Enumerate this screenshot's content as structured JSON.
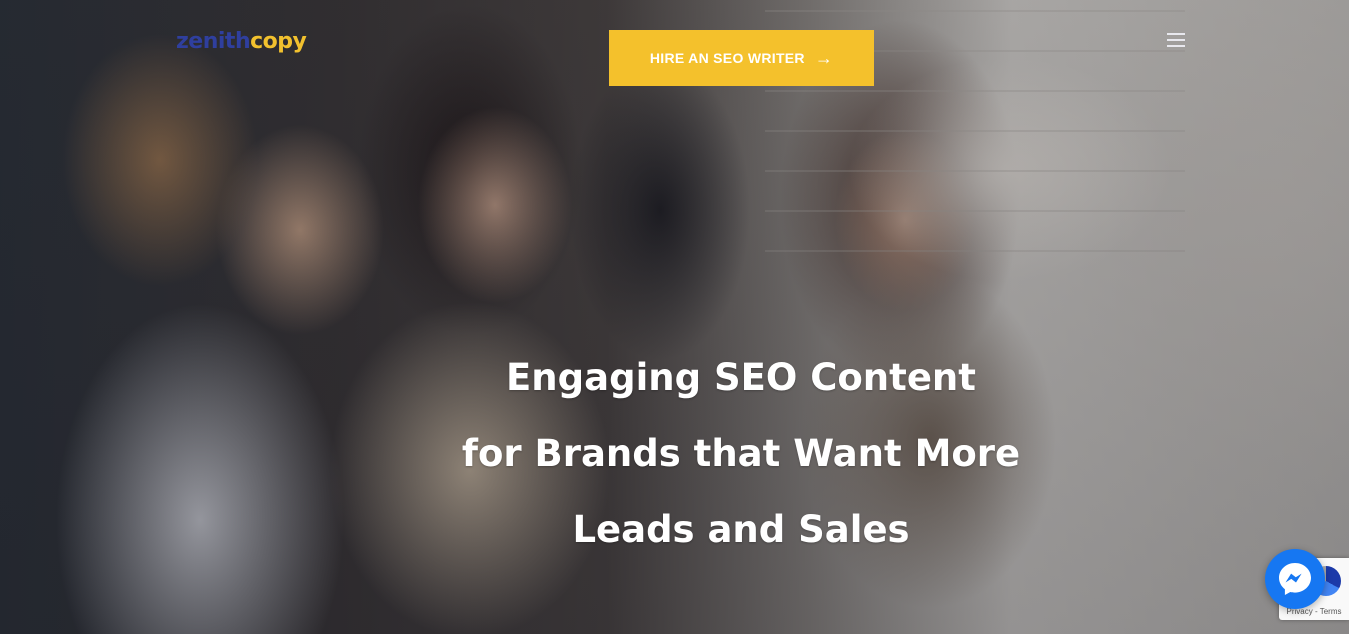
{
  "brand": {
    "logo_part1": "zenith",
    "logo_part2": "copy"
  },
  "header": {
    "cta_label": "HIRE AN SEO WRITER",
    "cta_icon": "arrow-right-icon",
    "menu_icon": "hamburger-menu-icon"
  },
  "hero": {
    "headline_line1": "Engaging SEO Content",
    "headline_line2": "for Brands that Want More",
    "headline_line3": "Leads and Sales"
  },
  "widgets": {
    "messenger_icon": "messenger-icon",
    "recaptcha_text": "Privacy - Terms"
  },
  "colors": {
    "accent": "#f4c12c",
    "logo_blue": "#2f3f9e",
    "messenger_blue": "#1677f2"
  }
}
